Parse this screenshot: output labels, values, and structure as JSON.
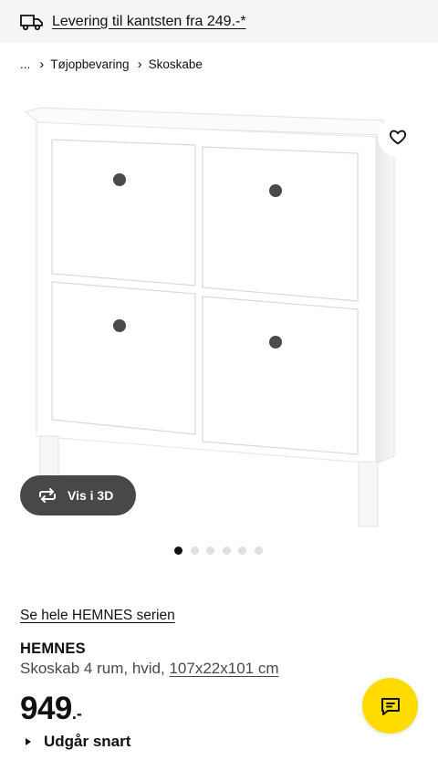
{
  "banner": {
    "icon": "delivery-truck-icon",
    "text": "Levering til kantsten fra 249.-*"
  },
  "breadcrumb": {
    "ellipsis": "...",
    "items": [
      "Tøjopbevaring",
      "Skoskabe"
    ]
  },
  "gallery": {
    "image_description": "White HEMNES shoe cabinet with 4 compartments and dark knobs",
    "view_3d_label": "Vis i 3D",
    "dot_count": 6,
    "active_dot": 0
  },
  "product": {
    "series_link": "Se hele HEMNES serien",
    "name": "HEMNES",
    "description": "Skoskab 4 rum, hvid, ",
    "dimensions": "107x22x101 cm",
    "price_integer": "949",
    "price_decimal": ".-",
    "availability": "Udgår snart"
  },
  "colors": {
    "accent_yellow": "#ffdb00",
    "banner_bg": "#f5f5f5",
    "button_dark": "#484848"
  }
}
